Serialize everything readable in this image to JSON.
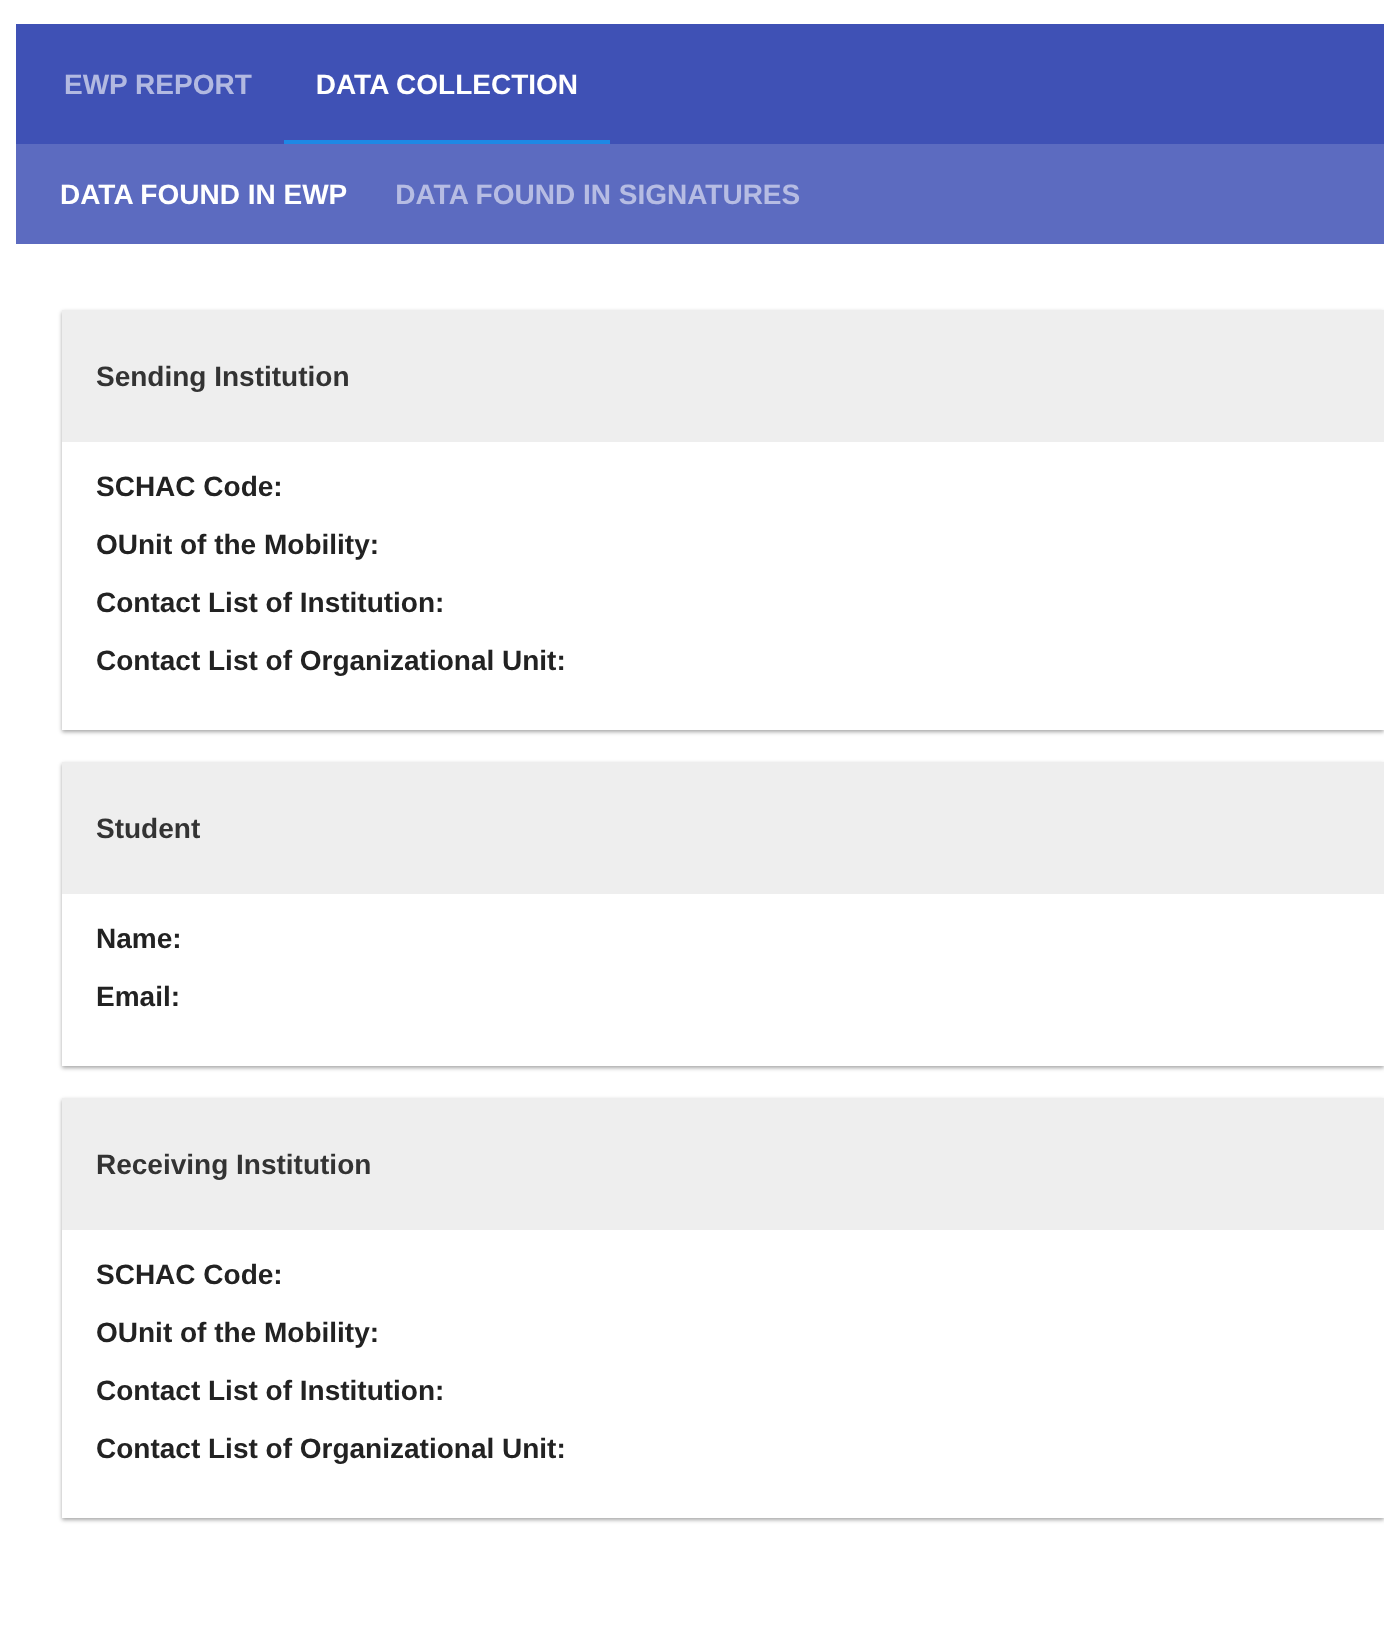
{
  "tabs": [
    {
      "label": "EWP REPORT",
      "selected": false
    },
    {
      "label": "DATA COLLECTION",
      "selected": true
    }
  ],
  "subtabs": [
    {
      "label": "DATA FOUND IN EWP",
      "selected": true
    },
    {
      "label": "DATA FOUND IN SIGNATURES",
      "selected": false
    }
  ],
  "sections": [
    {
      "title": "Sending Institution",
      "fields": [
        "SCHAC Code:",
        "OUnit of the Mobility:",
        "Contact List of Institution:",
        "Contact List of Organizational Unit:"
      ]
    },
    {
      "title": "Student",
      "fields": [
        "Name:",
        "Email:"
      ]
    },
    {
      "title": "Receiving Institution",
      "fields": [
        "SCHAC Code:",
        "OUnit of the Mobility:",
        "Contact List of Institution:",
        "Contact List of Organizational Unit:"
      ]
    }
  ]
}
